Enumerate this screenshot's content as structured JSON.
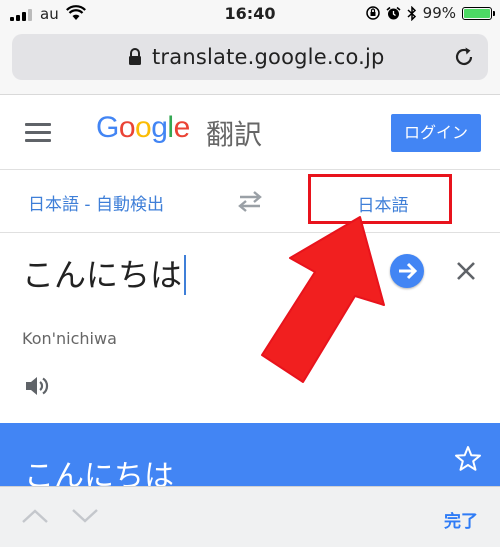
{
  "status_bar": {
    "carrier": "au",
    "time": "16:40",
    "battery_percent": "99%",
    "battery_level": 0.99,
    "icons": [
      "signal-icon",
      "wifi-icon",
      "orientation-lock-icon",
      "alarm-icon",
      "bluetooth-icon",
      "battery-icon"
    ]
  },
  "browser": {
    "url": "translate.google.co.jp",
    "icons": [
      "lock-icon",
      "reload-icon"
    ]
  },
  "header": {
    "logo_parts": [
      "G",
      "o",
      "o",
      "g",
      "l",
      "e"
    ],
    "product_name": "翻訳",
    "login_label": "ログイン",
    "icons": [
      "menu-icon"
    ]
  },
  "language_bar": {
    "source_language": "日本語 - 自動検出",
    "target_language": "日本語",
    "icons": [
      "swap-icon"
    ]
  },
  "input": {
    "text": "こんにちは",
    "romanization": "Kon'nichiwa",
    "icons": [
      "go-arrow-icon",
      "close-icon",
      "speaker-icon"
    ]
  },
  "result": {
    "text": "こんにちは",
    "icons": [
      "star-icon"
    ]
  },
  "keyboard_bar": {
    "done_label": "完了",
    "icons": [
      "chevron-up-icon",
      "chevron-down-icon"
    ]
  },
  "colors": {
    "google_blue": "#4285f4",
    "link_blue": "#3f7fd8",
    "annotation_red": "#e8131c"
  }
}
